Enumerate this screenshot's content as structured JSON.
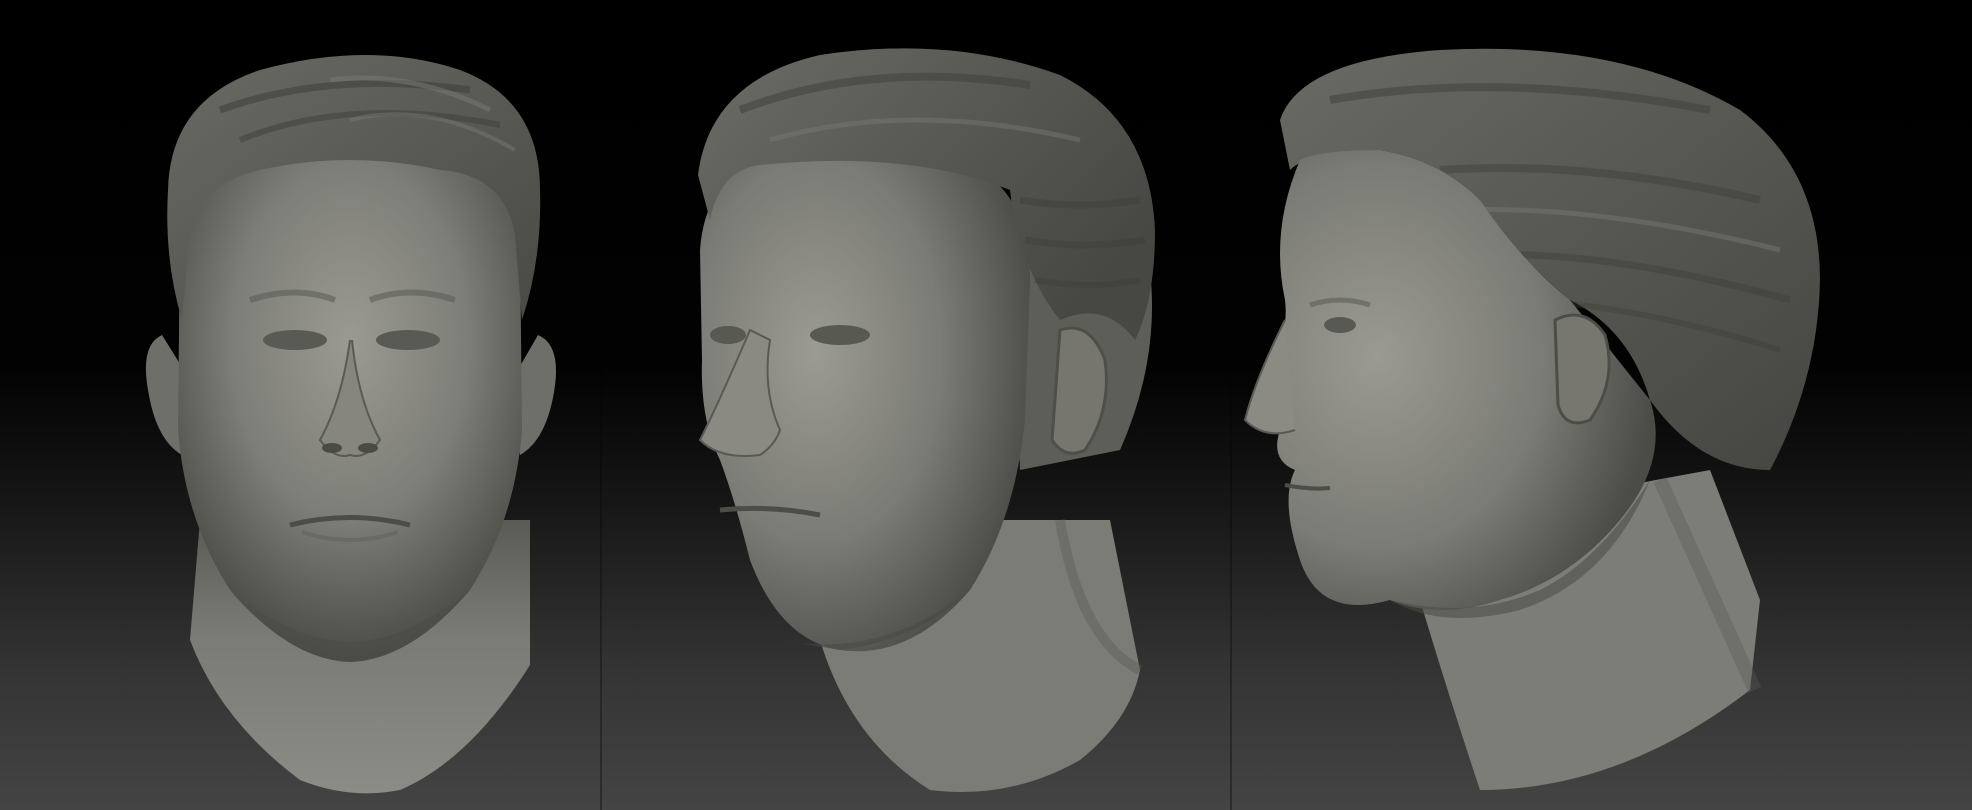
{
  "scene": {
    "background": {
      "top": "#000000",
      "bottom": "#444444"
    },
    "clay": {
      "base": "#7c7c76",
      "light": "#9a9a92",
      "shadow": "#3e3e3a",
      "hair": "#5e5e59",
      "hair_dark": "#40403c"
    },
    "views": [
      {
        "name": "front-view",
        "angle": "front"
      },
      {
        "name": "three-quarter-view",
        "angle": "three-quarter"
      },
      {
        "name": "profile-view",
        "angle": "side"
      }
    ]
  }
}
